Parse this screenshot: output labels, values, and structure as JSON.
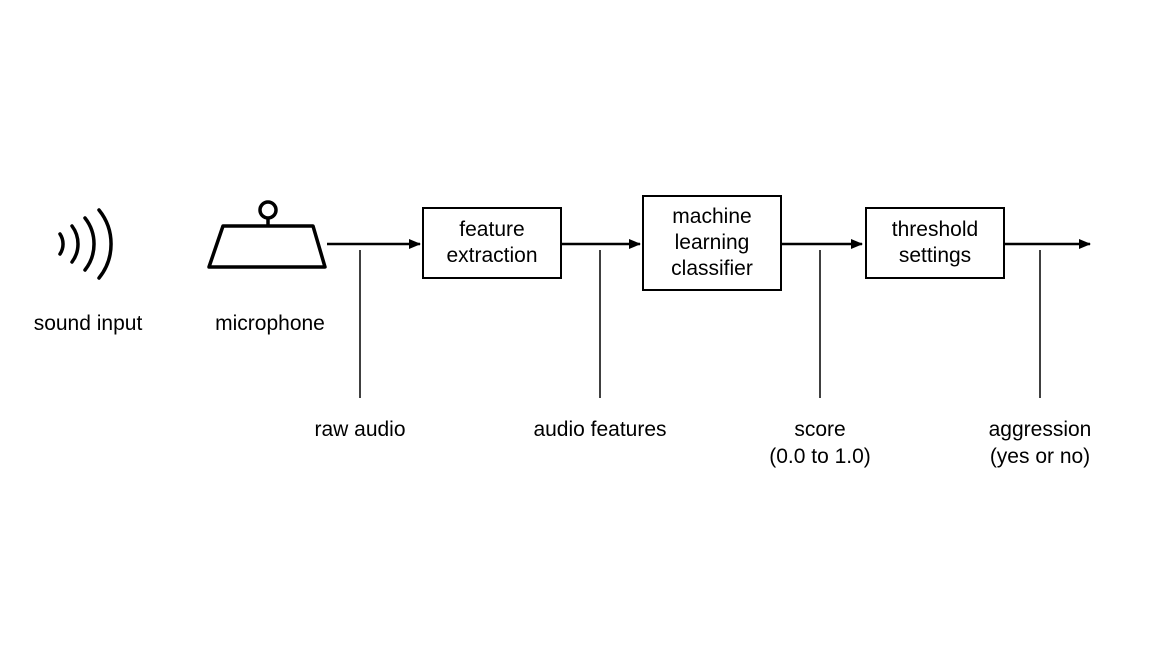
{
  "nodes": {
    "sound_input": {
      "label": "sound input"
    },
    "microphone": {
      "label": "microphone"
    },
    "feature_extraction": {
      "label": "feature\nextraction"
    },
    "ml_classifier": {
      "label": "machine\nlearning\nclassifier"
    },
    "threshold": {
      "label": "threshold\nsettings"
    }
  },
  "edges": {
    "raw_audio": {
      "label": "raw audio"
    },
    "audio_features": {
      "label": "audio features"
    },
    "score": {
      "label": "score\n(0.0 to 1.0)"
    },
    "aggression": {
      "label": "aggression\n(yes or no)"
    }
  }
}
